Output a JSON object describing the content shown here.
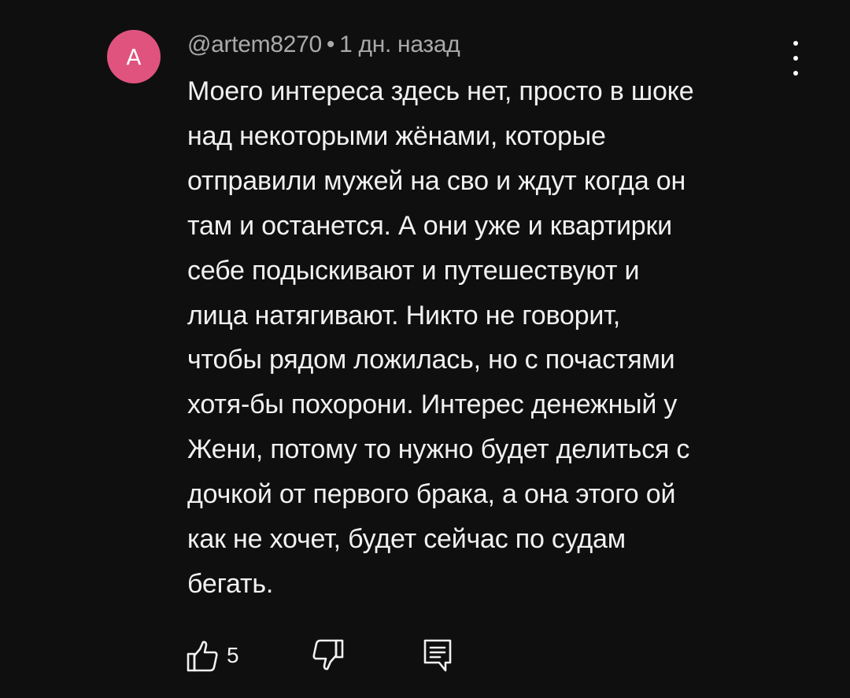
{
  "comment": {
    "avatar_letter": "A",
    "avatar_color": "#e0537f",
    "author": "@artem8270",
    "separator": "•",
    "time": "1 дн. назад",
    "text_lines": [
      "Моего интереса здесь нет, просто в шоке",
      "над некоторыми жёнами, которые",
      "отправили мужей на сво и ждут когда он",
      "там и останется. А они уже и квартирки",
      "себе подыскивают и путешествуют и",
      "лица натягивают. Никто не говорит,",
      "чтобы рядом ложилась, но с почастями",
      "хотя-бы похорони. Интерес денежный у",
      "Жени, потому то нужно будет делиться с",
      "дочкой от первого брака, а она этого ой",
      "как не хочет, будет сейчас по судам",
      "бегать."
    ],
    "like_count": "5"
  },
  "icons": {
    "menu": "more-vert-icon",
    "like": "thumb-up-icon",
    "dislike": "thumb-down-icon",
    "reply": "comment-reply-icon"
  },
  "colors": {
    "background": "#0f0f0f",
    "text": "#f1f1f1",
    "meta": "#aaaaaa"
  }
}
